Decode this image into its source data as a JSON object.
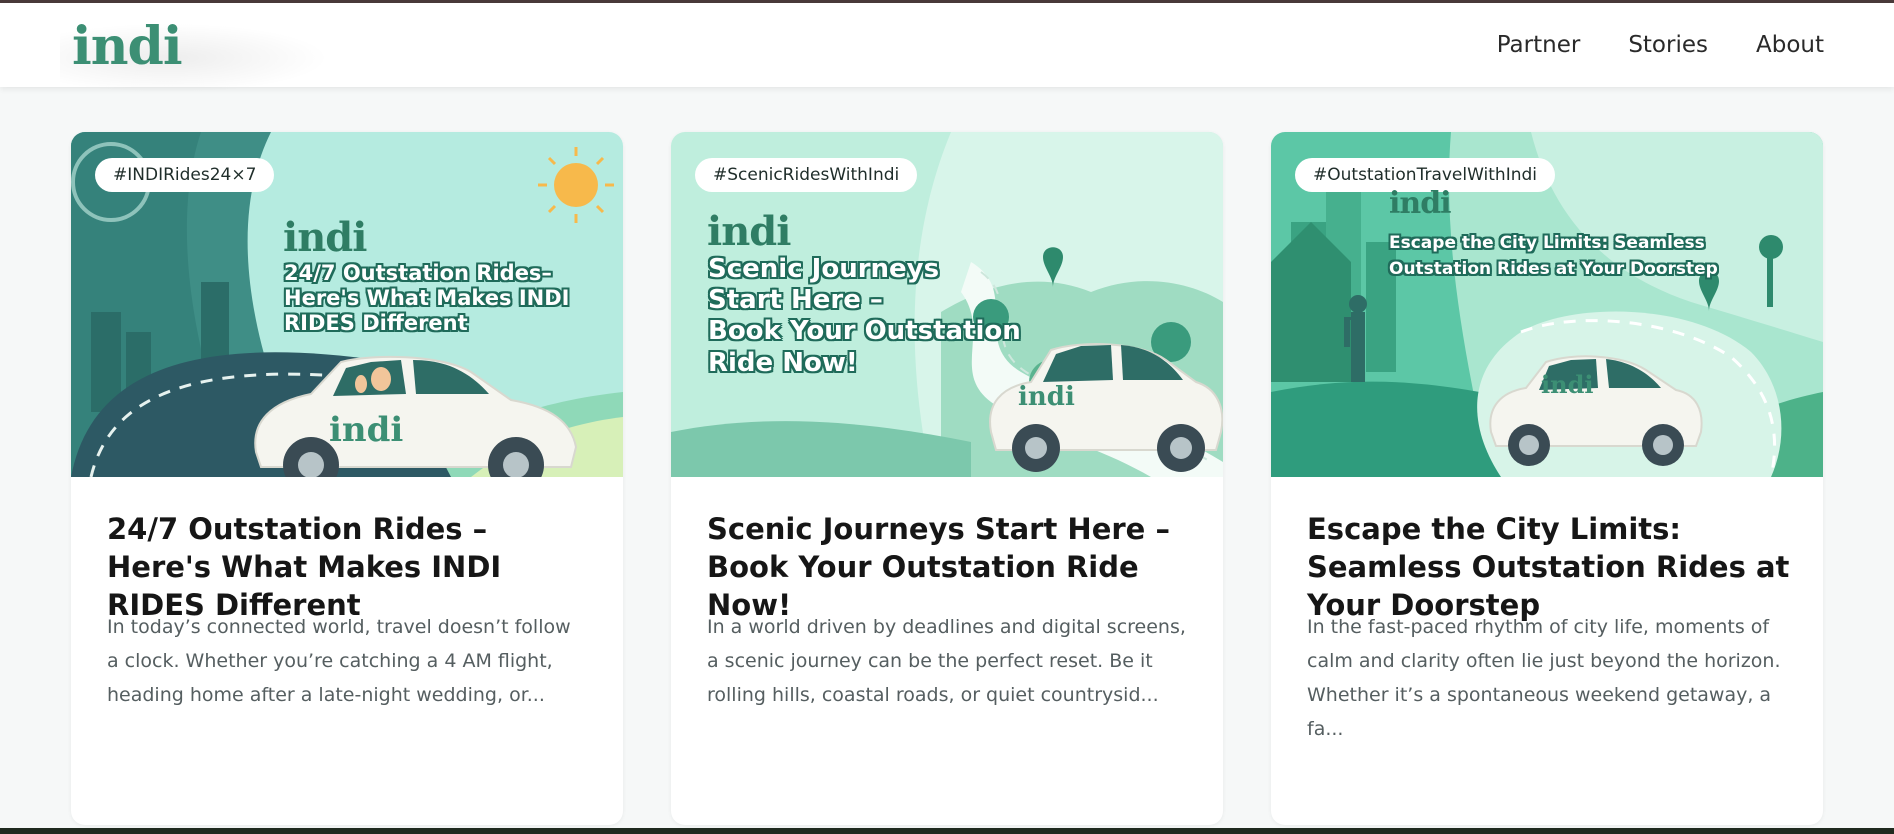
{
  "header": {
    "logo": "indi",
    "nav": [
      "Partner",
      "Stories",
      "About"
    ]
  },
  "colors": {
    "brand": "#3c8f74",
    "background": "#f6f8f8",
    "card": "#ffffff"
  },
  "cards": [
    {
      "tag": "#INDIRides24×7",
      "image_logo": "indi",
      "image_headline": [
        "24/7 Outstation Rides–",
        "Here's What Makes INDI",
        "RIDES Different"
      ],
      "car_logo": "indi",
      "title": "24/7 Outstation Rides – Here's What Makes INDI RIDES Different",
      "excerpt": "In today’s connected world, travel doesn’t follow a clock. Whether you’re catching a 4 AM flight, heading home after a late-night wedding, or..."
    },
    {
      "tag": "#ScenicRidesWithIndi",
      "image_logo": "indi",
      "image_headline": [
        "Scenic Journeys",
        "Start Here –",
        "Book Your Outstation",
        "Ride Now!"
      ],
      "car_logo": "indi",
      "title": "Scenic Journeys Start Here – Book Your Outstation Ride Now!",
      "excerpt": "In a world driven by deadlines and digital screens, a scenic journey can be the perfect reset. Be it rolling hills, coastal roads, or quiet countrysid..."
    },
    {
      "tag": "#OutstationTravelWithIndi",
      "image_logo": "indi",
      "image_headline": [
        "Escape the City Limits: Seamless",
        "Outstation Rides at Your Doorstep"
      ],
      "car_logo": "indi",
      "title": "Escape the City Limits: Seamless Outstation Rides at Your Doorstep",
      "excerpt": "In the fast-paced rhythm of city life, moments of calm and clarity often lie just beyond the horizon. Whether it’s a spontaneous weekend getaway, a fa..."
    }
  ]
}
